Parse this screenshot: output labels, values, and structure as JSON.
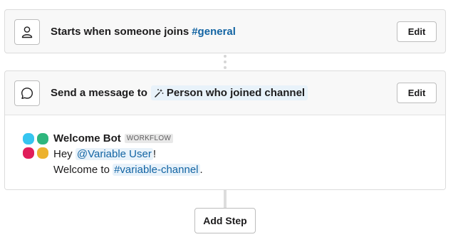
{
  "trigger": {
    "icon": "person-icon",
    "title": "Starts when someone joins",
    "channel": "#general",
    "edit_label": "Edit"
  },
  "step": {
    "icon": "message-bubble-icon",
    "title": "Send a message to",
    "variable_icon": "magic-wand-icon",
    "recipient": "Person who joined channel",
    "edit_label": "Edit",
    "message": {
      "sender": "Welcome Bot",
      "badge": "WORKFLOW",
      "greeting": "Hey",
      "mention_user": "@Variable User",
      "greeting_end": "!",
      "welcome": "Welcome to",
      "mention_channel": "#variable-channel",
      "welcome_end": ".",
      "avatar_colors": [
        "#36c5f0",
        "#2eb67d",
        "#e01e5a",
        "#ecb22e"
      ]
    }
  },
  "add_step_label": "Add Step",
  "colors": {
    "link": "#1264a3",
    "pill_bg": "#e8f2fa",
    "card_bg": "#f8f8f8"
  }
}
